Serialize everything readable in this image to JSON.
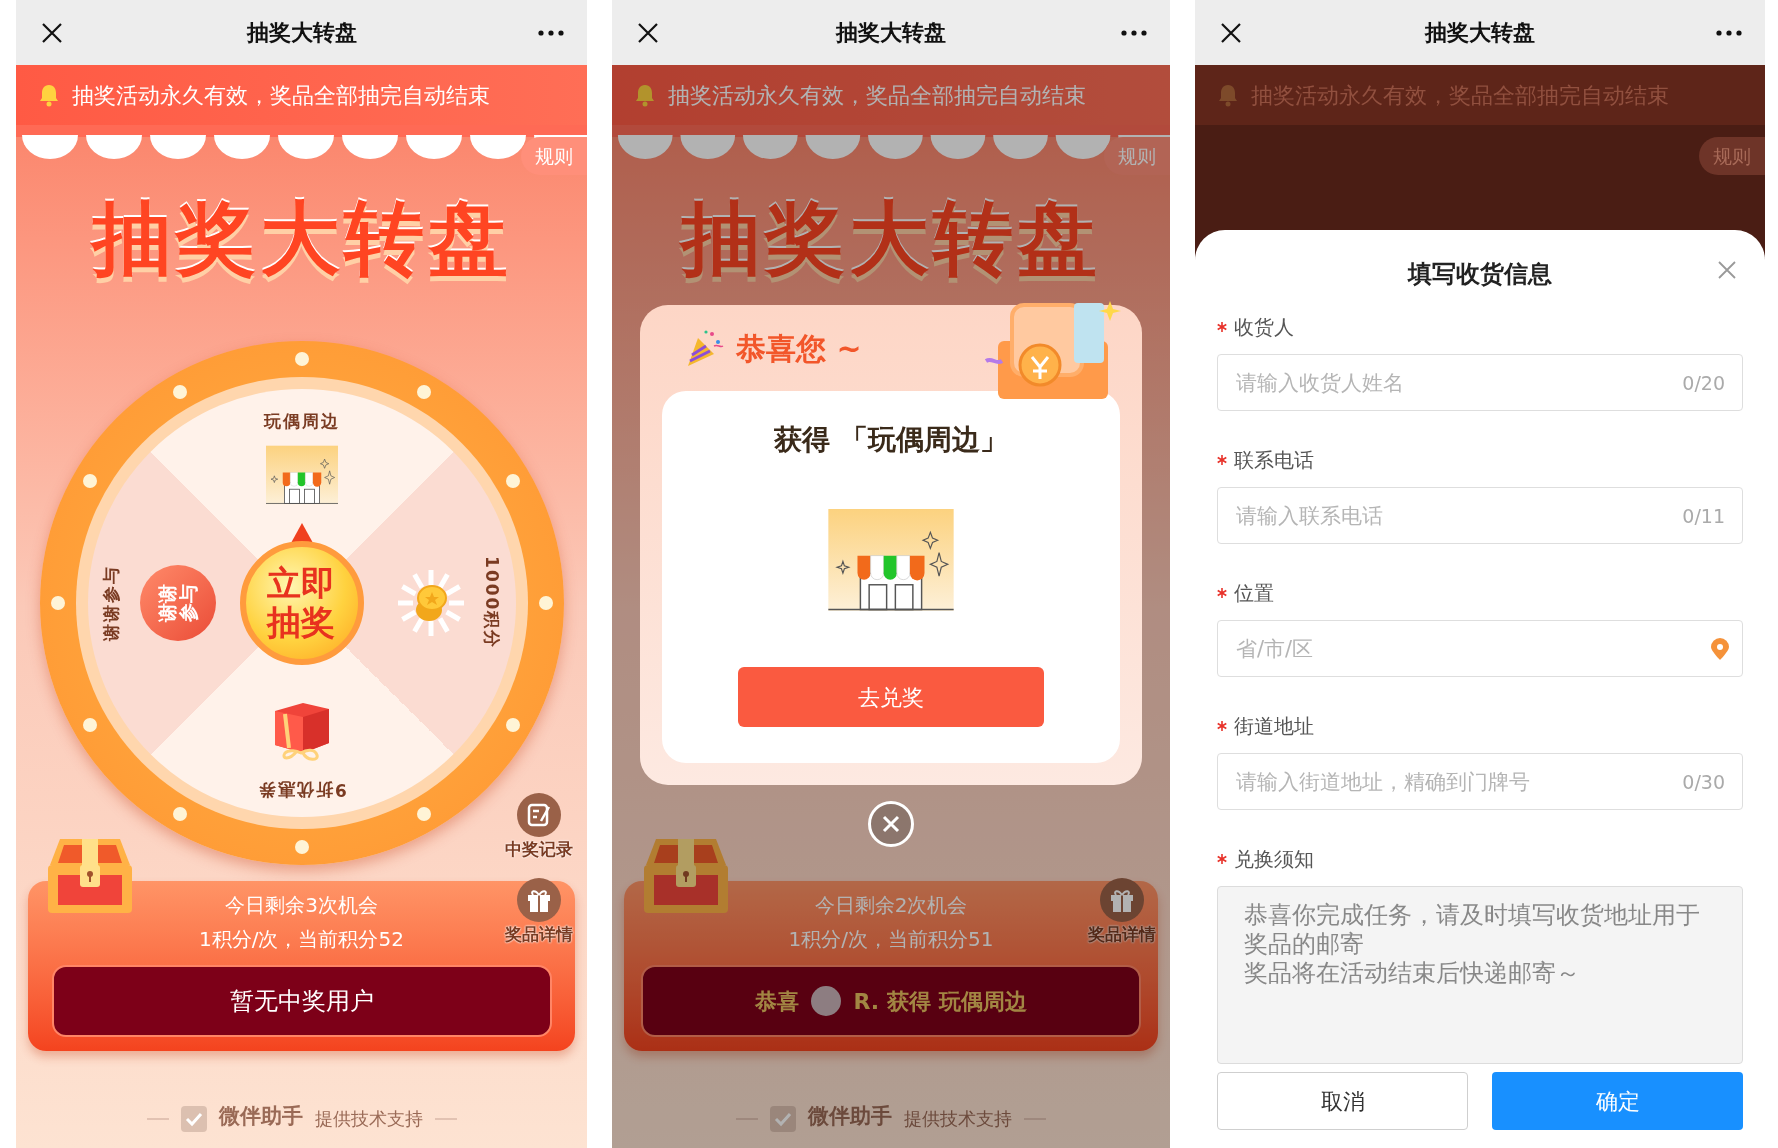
{
  "lottery_screen": {
    "title": "抽奖大转盘",
    "notice": "抽奖活动永久有效，奖品全部抽完自动结束",
    "rules": "规则",
    "banner": "抽奖大转盘",
    "wheel": {
      "spin_button": "立即抽奖",
      "prizes": [
        {
          "label": "玩偶周边",
          "kind": "shop"
        },
        {
          "label": "1000积分",
          "kind": "coins"
        },
        {
          "label": "9折优惠券",
          "kind": "gift"
        },
        {
          "label": "谢谢参与",
          "kind": "thanks",
          "badge": "谢谢参与"
        }
      ]
    },
    "side_buttons": [
      {
        "label": "中奖记录",
        "kind": "records"
      },
      {
        "label": "奖品详情",
        "kind": "prizes"
      }
    ],
    "chances": "今日剩余3次机会",
    "cost": "1积分/次，当前积分52",
    "winners": {
      "text": "暂无中奖用户"
    },
    "footer": {
      "brand": "微伴助手",
      "tagline": "提供技术支持"
    }
  },
  "result_screen": {
    "title": "抽奖大转盘",
    "notice": "抽奖活动永久有效，奖品全部抽完自动结束",
    "rules": "规则",
    "banner": "抽奖大转盘",
    "side_buttons": [
      {
        "label": "奖品详情",
        "kind": "prizes"
      }
    ],
    "chances": "今日剩余2次机会",
    "cost": "1积分/次，当前积分51",
    "winners": {
      "prefix": "恭喜",
      "text": "R. 获得 玩偶周边"
    },
    "footer": {
      "brand": "微伴助手",
      "tagline": "提供技术支持"
    },
    "modal": {
      "heading": "恭喜您 ~",
      "prize_title": "获得 「玩偶周边」",
      "button": "去兑奖"
    }
  },
  "form_screen": {
    "title": "抽奖大转盘",
    "notice": "抽奖活动永久有效，奖品全部抽完自动结束",
    "rules": "规则",
    "sheet": {
      "title": "填写收货信息",
      "fields": [
        {
          "label": "收货人",
          "required": true,
          "kind": "text",
          "placeholder": "请输入收货人姓名",
          "counter": "0/20"
        },
        {
          "label": "联系电话",
          "required": true,
          "kind": "text",
          "placeholder": "请输入联系电话",
          "counter": "0/11"
        },
        {
          "label": "位置",
          "required": true,
          "kind": "location",
          "placeholder": "省/市/区"
        },
        {
          "label": "街道地址",
          "required": true,
          "kind": "text",
          "placeholder": "请输入街道地址，精确到门牌号",
          "counter": "0/30"
        },
        {
          "label": "兑换须知",
          "required": true,
          "kind": "note",
          "lines": [
            "恭喜你完成任务，请及时填写收货地址用于奖品的邮寄",
            "奖品将在活动结束后快递邮寄～"
          ]
        }
      ],
      "buttons": [
        {
          "label": "取消",
          "kind": "secondary"
        },
        {
          "label": "确定",
          "kind": "primary"
        }
      ]
    }
  }
}
